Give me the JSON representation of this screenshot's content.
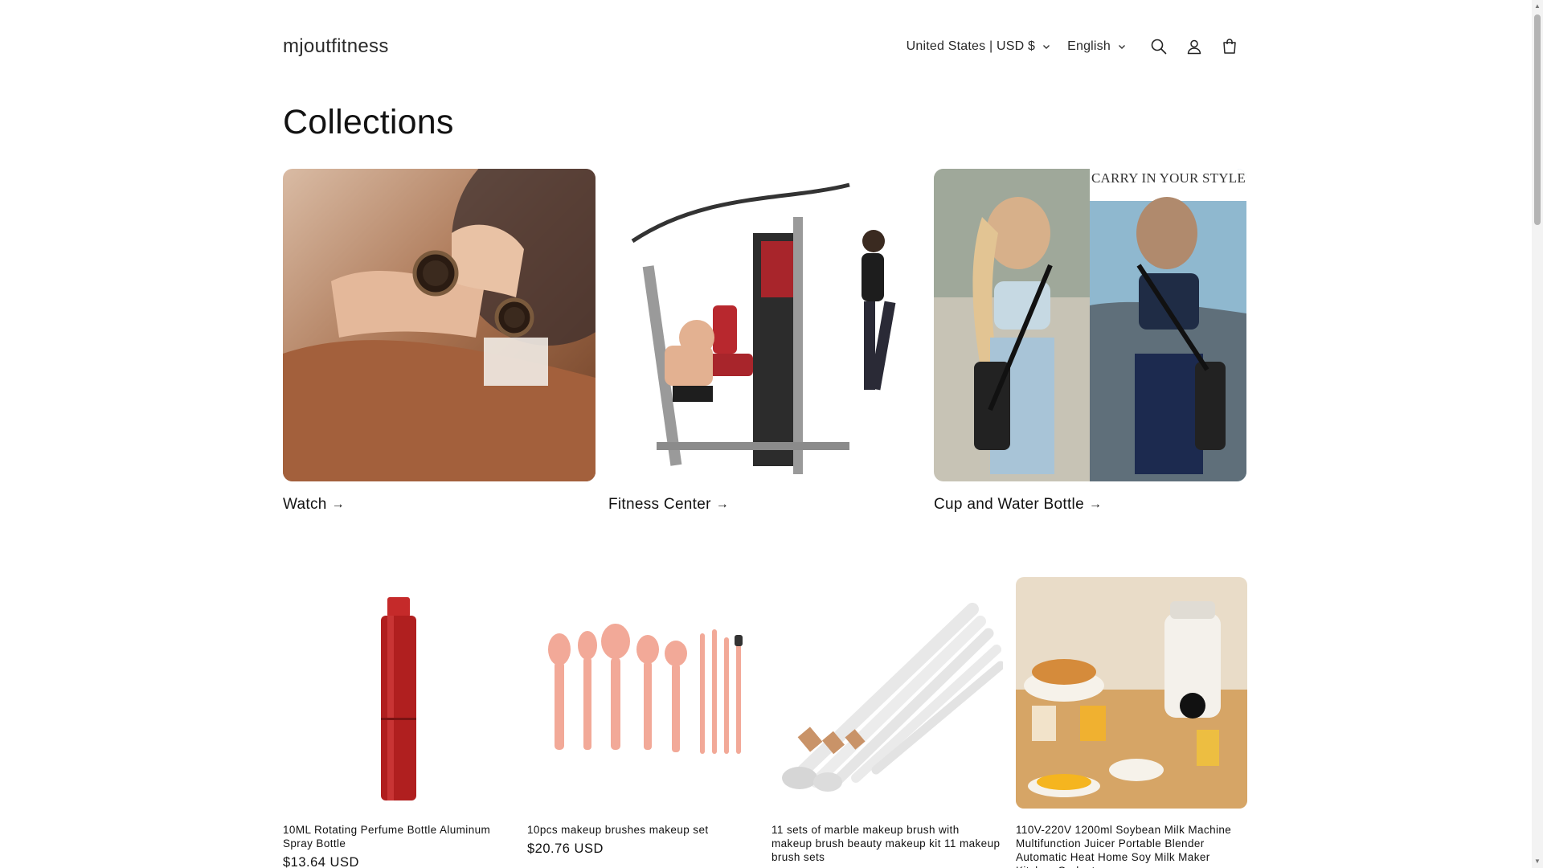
{
  "header": {
    "logo": "mjoutfitness",
    "country_selector": "United States | USD $",
    "language_selector": "English",
    "icons": [
      "search-icon",
      "account-icon",
      "cart-icon"
    ]
  },
  "page": {
    "title": "Collections"
  },
  "collections": [
    {
      "label": "Watch",
      "arrow": "→"
    },
    {
      "label": "Fitness Center",
      "arrow": "→"
    },
    {
      "label": "Cup and Water Bottle",
      "arrow": "→"
    }
  ],
  "collection_image_text": "CARRY IN YOUR STYLE",
  "products": [
    {
      "title": "10ML Rotating Perfume Bottle Aluminum Spray Bottle",
      "price": "$13.64 USD"
    },
    {
      "title": "10pcs makeup brushes makeup set",
      "price": "$20.76 USD"
    },
    {
      "title": "11 sets of marble makeup brush with makeup brush beauty makeup kit 11 makeup brush sets",
      "price": ""
    },
    {
      "title": "110V-220V 1200ml Soybean Milk Machine Multifunction Juicer Portable Blender Automatic Heat Home Soy Milk Maker Kitchen Gadgets",
      "price": ""
    }
  ],
  "colors": {
    "text": "#121212",
    "background": "#ffffff",
    "scrollbar_thumb": "#b4b4b4"
  }
}
